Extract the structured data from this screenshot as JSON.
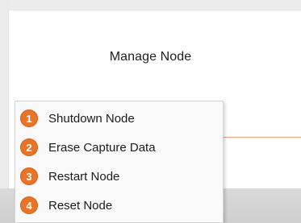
{
  "header": {
    "title": "Manage Node"
  },
  "context_menu": {
    "items": [
      {
        "number": "1",
        "label": "Shutdown Node"
      },
      {
        "number": "2",
        "label": "Erase Capture Data"
      },
      {
        "number": "3",
        "label": "Restart Node"
      },
      {
        "number": "4",
        "label": "Reset Node"
      }
    ]
  },
  "colors": {
    "badge": "#e8742a",
    "accent_line": "#f0a080"
  }
}
